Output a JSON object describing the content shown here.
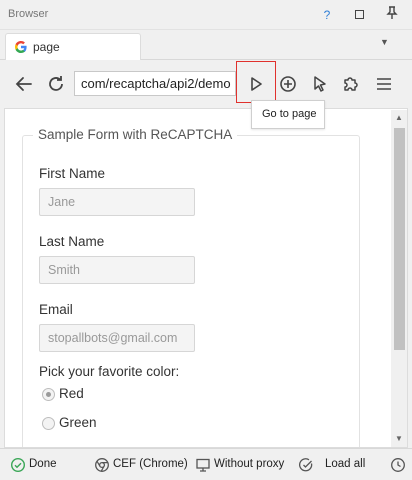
{
  "window": {
    "title": "Browser"
  },
  "tabs": [
    {
      "label": "page"
    }
  ],
  "nav": {
    "address": "com/recaptcha/api2/demo",
    "go_tooltip": "Go to page"
  },
  "form": {
    "legend": "Sample Form with ReCAPTCHA",
    "first_name": {
      "label": "First Name",
      "value": "Jane"
    },
    "last_name": {
      "label": "Last Name",
      "value": "Smith"
    },
    "email": {
      "label": "Email",
      "value": "stopallbots@gmail.com"
    },
    "color_question": "Pick your favorite color:",
    "color_options": [
      {
        "label": "Red",
        "checked": true
      },
      {
        "label": "Green",
        "checked": false
      }
    ]
  },
  "status": {
    "state": "Done",
    "engine": "CEF (Chrome)",
    "proxy": "Without proxy",
    "load": "Load all"
  },
  "colors": {
    "accent_blue": "#2f7fd7",
    "highlight_red": "#e0312d",
    "ok_green": "#3aa657"
  }
}
